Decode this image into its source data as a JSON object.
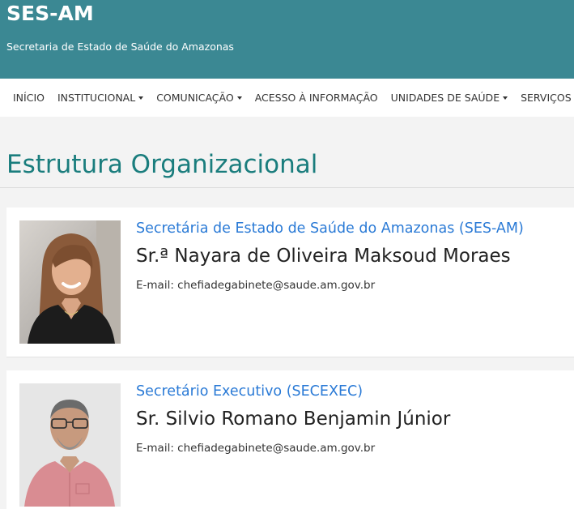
{
  "header": {
    "site_name": "SES-AM",
    "slogan": "Secretaria de Estado de Saúde do Amazonas",
    "background_color": "#3b8893"
  },
  "nav": {
    "items": [
      {
        "label": "INÍCIO",
        "dropdown": false
      },
      {
        "label": "INSTITUCIONAL",
        "dropdown": true
      },
      {
        "label": "COMUNICAÇÃO",
        "dropdown": true
      },
      {
        "label": "ACESSO À INFORMAÇÃO",
        "dropdown": false
      },
      {
        "label": "UNIDADES DE SAÚDE",
        "dropdown": true
      },
      {
        "label": "SERVIÇOS",
        "dropdown": true
      }
    ]
  },
  "page": {
    "title": "Estrutura Organizacional",
    "title_color": "#1a7d7d"
  },
  "cards": [
    {
      "role": "Secretária de Estado de Saúde do Amazonas (SES-AM)",
      "name": "Sr.ª Nayara de Oliveira Maksoud Moraes",
      "email": "E-mail: chefiadegabinete@saude.am.gov.br"
    },
    {
      "role": "Secretário Executivo (SECEXEC)",
      "name": "Sr. Silvio Romano Benjamin Júnior",
      "email": "E-mail: chefiadegabinete@saude.am.gov.br"
    }
  ],
  "colors": {
    "role_link": "#2a7ad6"
  }
}
